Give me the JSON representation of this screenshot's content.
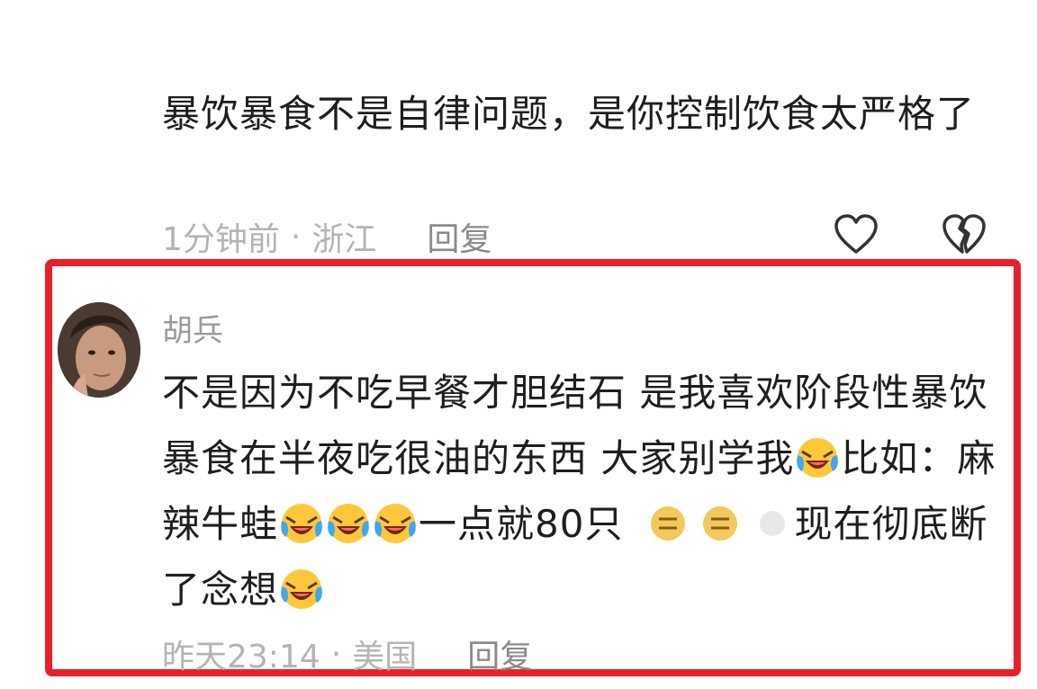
{
  "comment_1": {
    "text": "暴饮暴食不是自律问题，是你控制饮食太严格了",
    "time": "1分钟前",
    "separator": "·",
    "location": "浙江",
    "reply_label": "回复"
  },
  "comment_2": {
    "username": "胡兵",
    "text_part_1": "不是因为不吃早餐才胆结石 是我喜欢阶段性暴饮暴食在半夜吃很油的东西 大家别学我",
    "text_part_2": "比如：麻辣牛蛙",
    "text_part_3": "一点就80只",
    "text_part_4": "现在彻底断了念想",
    "time": "昨天23:14",
    "separator": "·",
    "location": "美国",
    "reply_label": "回复",
    "emoji_name": "laughing-crying-emoji"
  },
  "colors": {
    "highlight": "#e8202a",
    "text": "#1e1e1e",
    "meta": "#b4b4b4",
    "emoji_face": "#ffc83a",
    "emoji_tear": "#3fa6f2"
  }
}
